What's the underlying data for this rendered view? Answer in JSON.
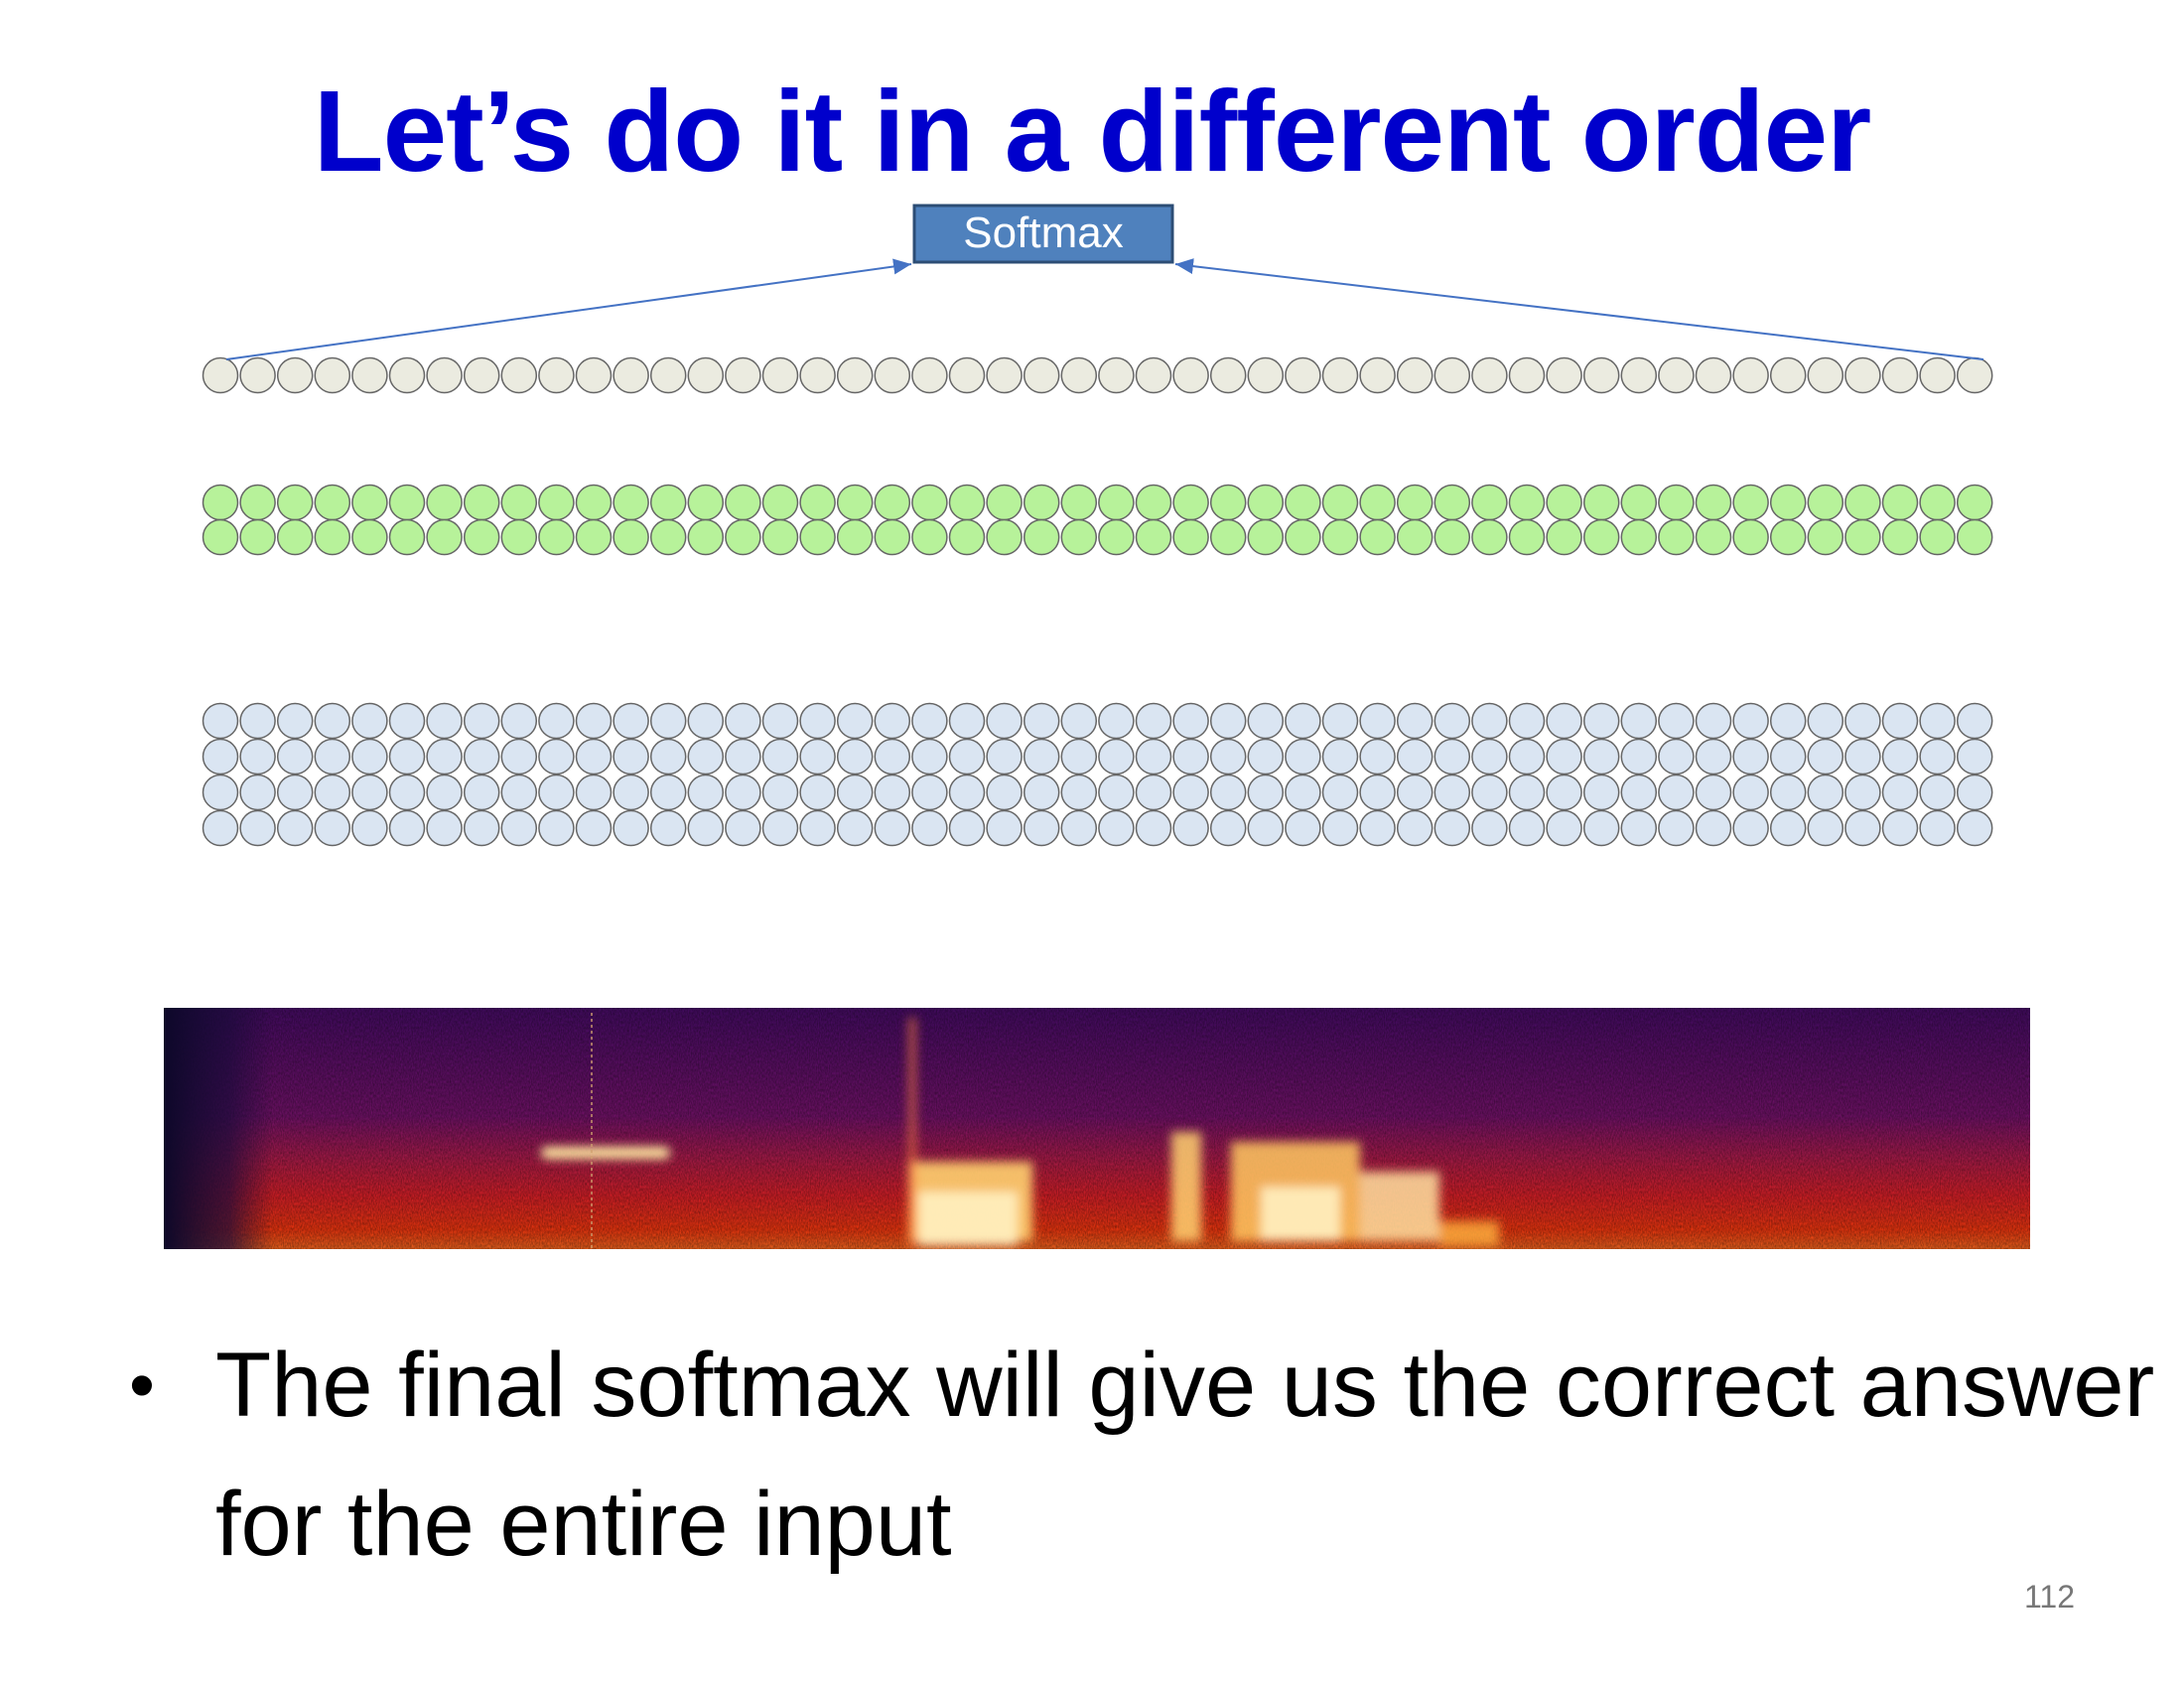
{
  "slide": {
    "title": "Let’s do it in a different order",
    "softmax_label": "Softmax",
    "bullet": "The final softmax will give us the correct answer for the entire input",
    "page_number": "112"
  },
  "network": {
    "columns": 48,
    "output_rows": 1,
    "hidden_rows": 2,
    "input_rows": 4,
    "colors": {
      "output": "#ebebe0",
      "hidden": "#b7f29a",
      "input": "#dae5f2",
      "node_stroke": "#666666",
      "softmax_fill": "#4f81bd",
      "softmax_border": "#2c4d75",
      "arrow": "#4472c4"
    }
  },
  "spectrogram": {
    "colormap": "inferno",
    "colors": [
      "#0d0829",
      "#4a0c6b",
      "#a31c5f",
      "#ff2000",
      "#ffe6a0"
    ]
  },
  "icons": {
    "bullet": "bullet-dot-icon"
  }
}
